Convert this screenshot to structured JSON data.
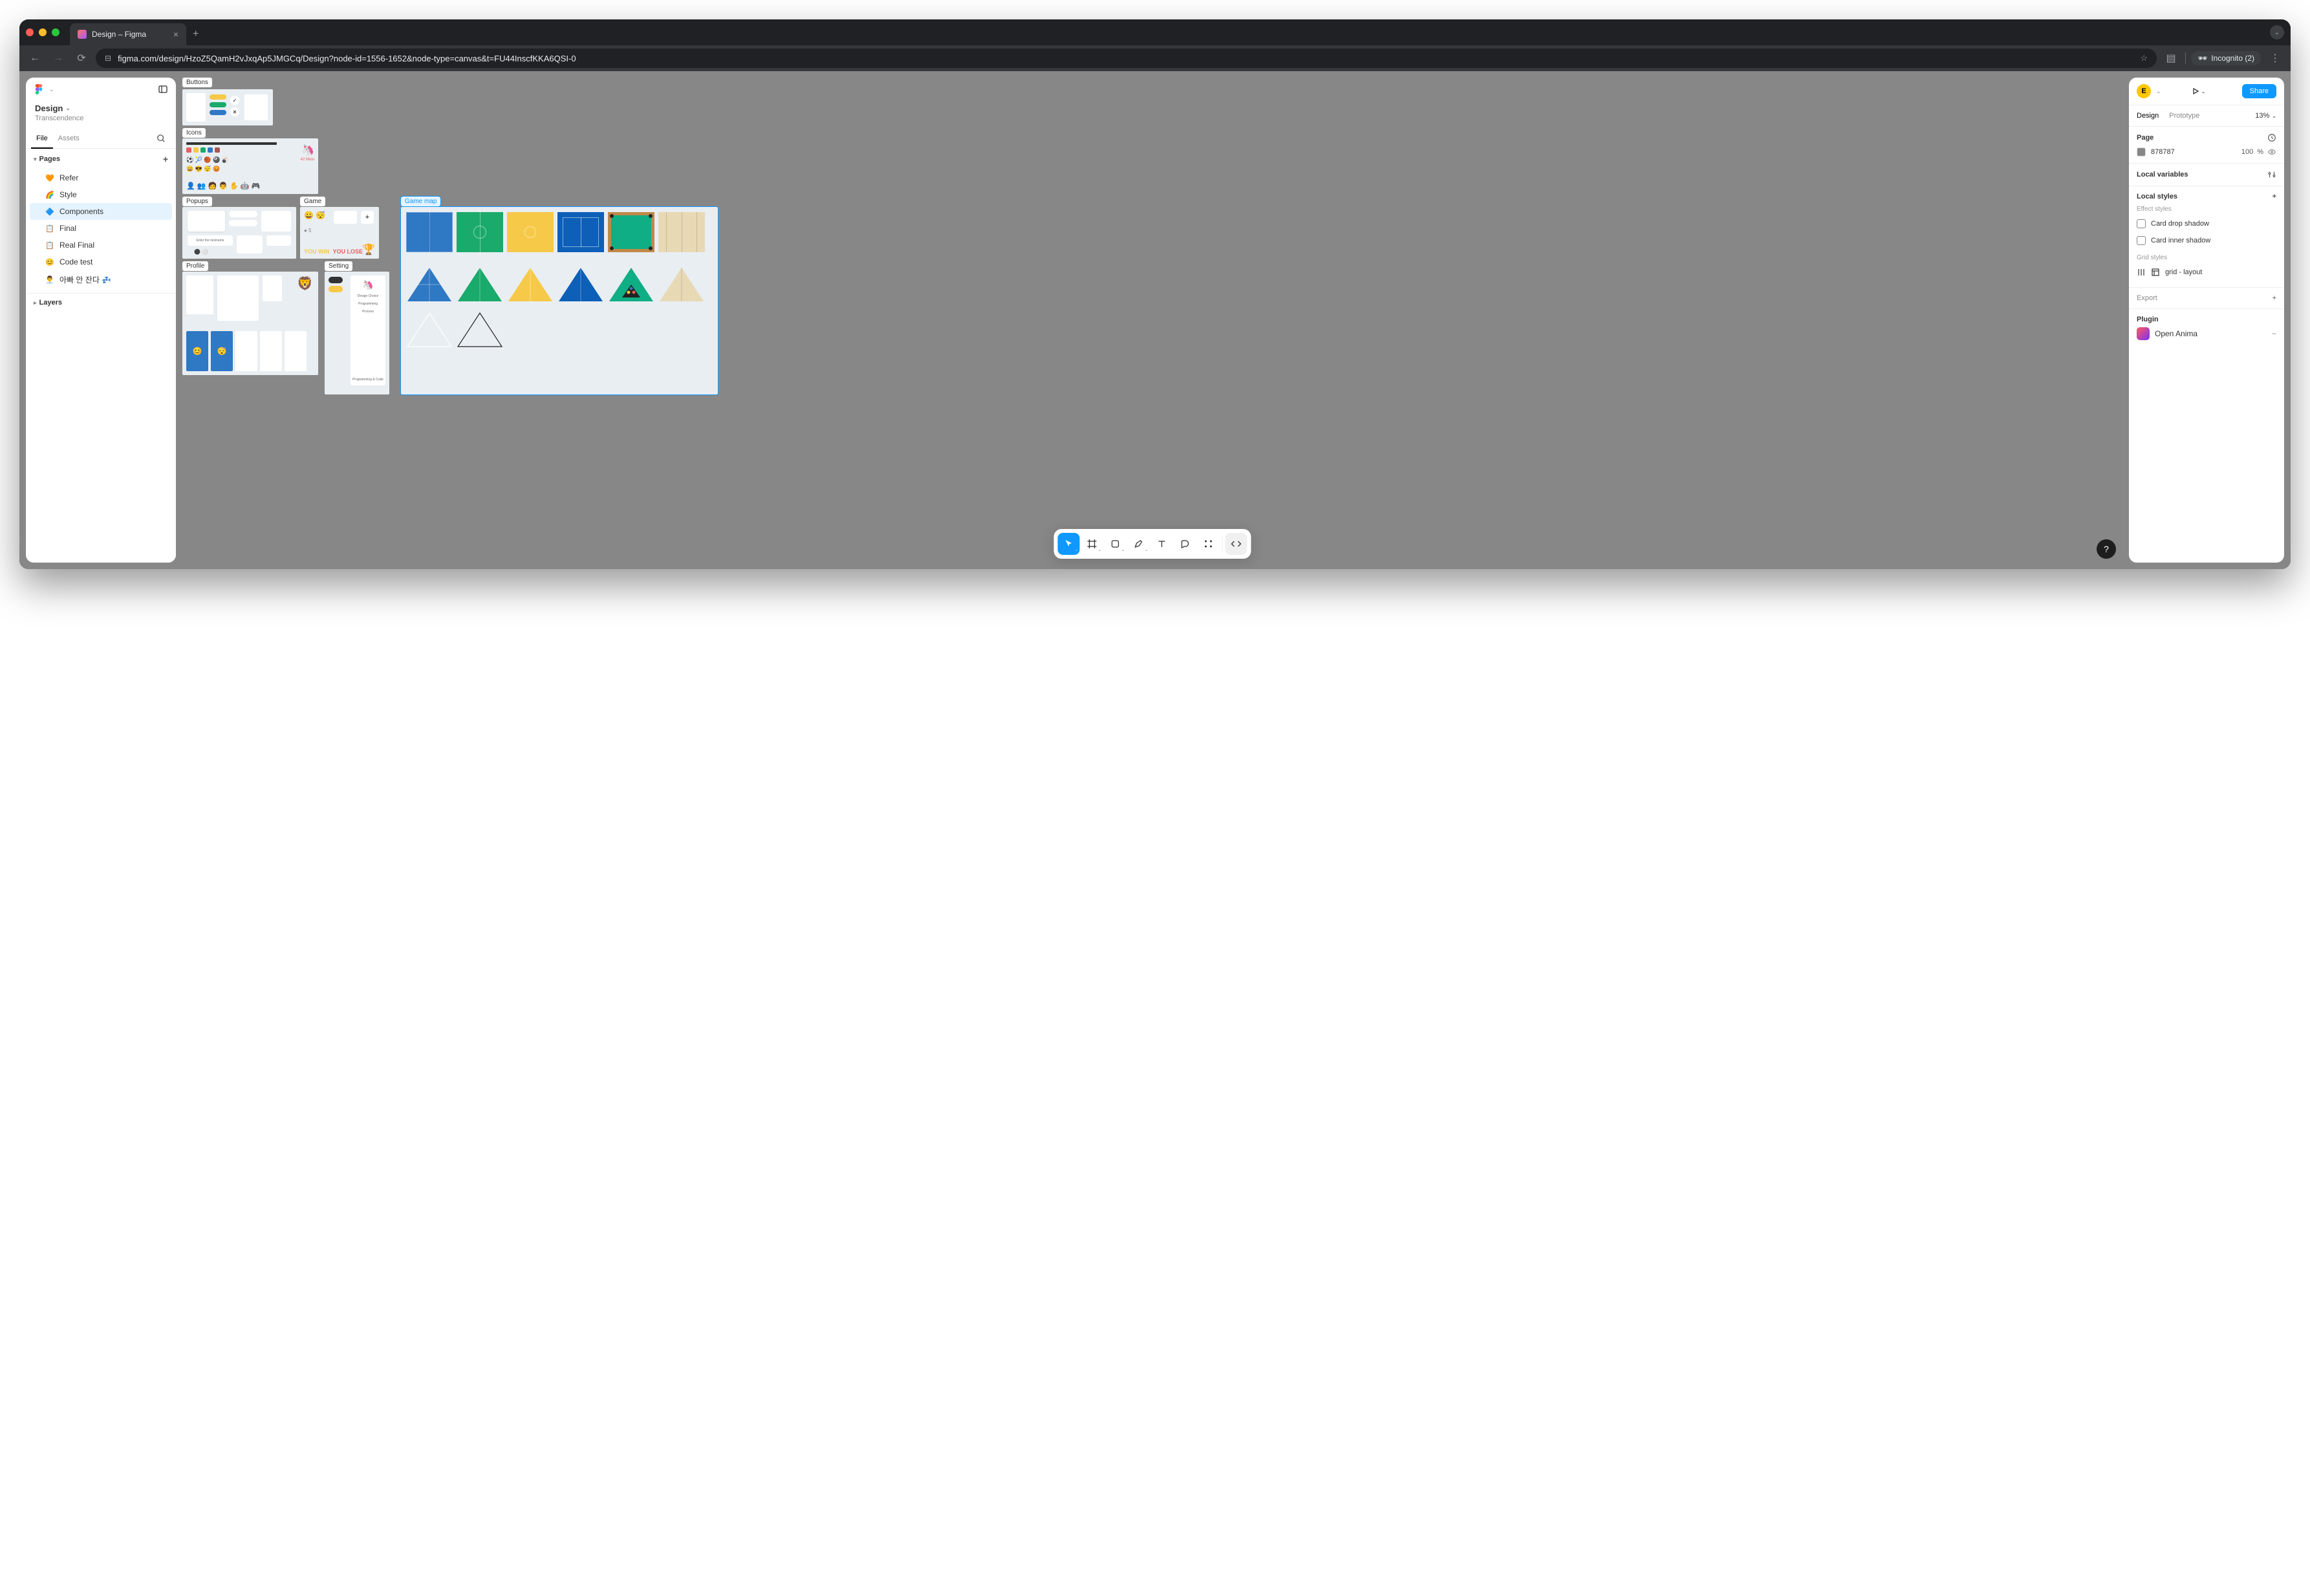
{
  "browser": {
    "tab_title": "Design – Figma",
    "url": "figma.com/design/HzoZ5QamH2vJxqAp5JMGCq/Design?node-id=1556-1652&node-type=canvas&t=FU44InscfKKA6QSI-0",
    "incognito_label": "Incognito (2)"
  },
  "left": {
    "doc_title": "Design",
    "team": "Transcendence",
    "tabs": {
      "file": "File",
      "assets": "Assets"
    },
    "pages_label": "Pages",
    "layers_label": "Layers",
    "pages": [
      {
        "emoji": "🧡",
        "name": "Refer"
      },
      {
        "emoji": "🌈",
        "name": "Style"
      },
      {
        "emoji": "🔷",
        "name": "Components",
        "active": true
      },
      {
        "emoji": "📋",
        "name": "Final"
      },
      {
        "emoji": "📋",
        "name": "Real Final"
      },
      {
        "emoji": "😊",
        "name": "Code test"
      },
      {
        "emoji": "👨‍💼",
        "name": "아빠 안 잔다 💤"
      }
    ]
  },
  "right": {
    "avatar_letter": "E",
    "share": "Share",
    "design_tab": "Design",
    "prototype_tab": "Prototype",
    "zoom": "13%",
    "page_label": "Page",
    "page_color_hex": "878787",
    "page_opacity": "100",
    "page_opacity_unit": "%",
    "local_vars": "Local variables",
    "local_styles": "Local styles",
    "effect_styles": "Effect styles",
    "style_shadow": "Card drop shadow",
    "style_inner": "Card inner shadow",
    "grid_styles": "Grid styles",
    "grid_layout": "grid - layout",
    "export": "Export",
    "plugin": "Plugin",
    "plugin_name": "Open Anima"
  },
  "canvas": {
    "frames": {
      "buttons": "Buttons",
      "icons": "Icons",
      "popups": "Popups",
      "game": "Game",
      "profile": "Profile",
      "setting": "Setting",
      "gamemap": "Game map"
    }
  },
  "colors": {
    "blue": "#2f78c4",
    "green": "#1aaa6b",
    "yellow": "#f7c948",
    "darkblue": "#0d5fb8",
    "pool_green": "#0fae84",
    "pool_wood": "#c08848",
    "bowling": "#e8d9b5"
  }
}
